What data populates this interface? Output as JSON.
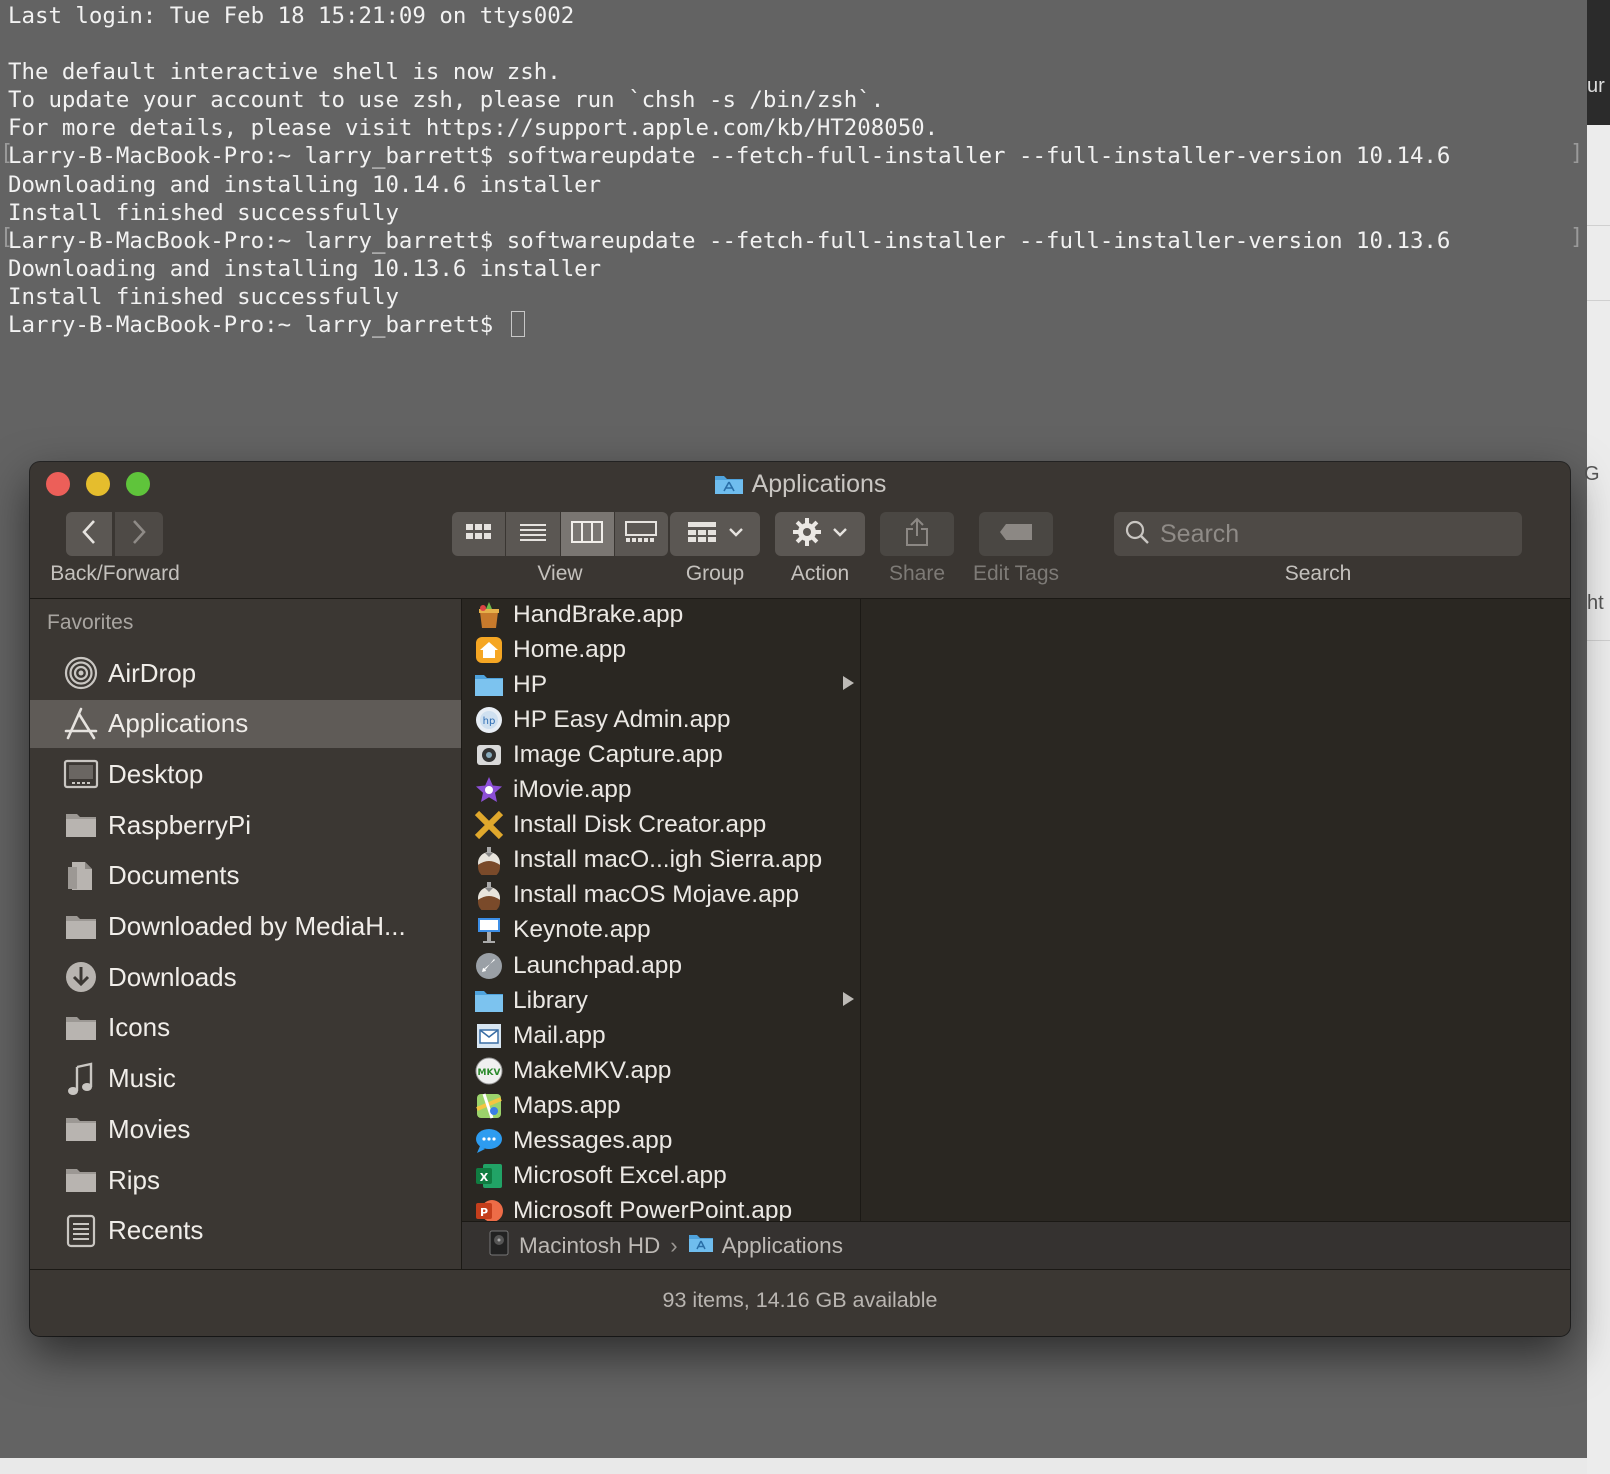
{
  "terminal": {
    "lines": [
      "Last login: Tue Feb 18 15:21:09 on ttys002",
      "",
      "The default interactive shell is now zsh.",
      "To update your account to use zsh, please run `chsh -s /bin/zsh`.",
      "For more details, please visit https://support.apple.com/kb/HT208050.",
      "Larry-B-MacBook-Pro:~ larry_barrett$ softwareupdate --fetch-full-installer --full-installer-version 10.14.6",
      "Downloading and installing 10.14.6 installer",
      "Install finished successfully",
      "Larry-B-MacBook-Pro:~ larry_barrett$ softwareupdate --fetch-full-installer --full-installer-version 10.13.6",
      "Downloading and installing 10.13.6 installer",
      "Install finished successfully"
    ],
    "prompt": "Larry-B-MacBook-Pro:~ larry_barrett$ ",
    "bg_color": "#636363",
    "text_color": "#f2f2f2"
  },
  "background_window": {
    "fragments": [
      "ur",
      "G",
      "ht"
    ]
  },
  "finder": {
    "title": "Applications",
    "toolbar": {
      "back_forward_label": "Back/Forward",
      "view_label": "View",
      "group_label": "Group",
      "action_label": "Action",
      "share_label": "Share",
      "edit_tags_label": "Edit Tags",
      "search_label": "Search",
      "search_placeholder": "Search"
    },
    "sidebar": {
      "header": "Favorites",
      "items": [
        {
          "label": "AirDrop",
          "icon": "airdrop-icon",
          "selected": false
        },
        {
          "label": "Applications",
          "icon": "applications-icon",
          "selected": true
        },
        {
          "label": "Desktop",
          "icon": "desktop-icon",
          "selected": false
        },
        {
          "label": "RaspberryPi",
          "icon": "folder-icon",
          "selected": false
        },
        {
          "label": "Documents",
          "icon": "documents-icon",
          "selected": false
        },
        {
          "label": "Downloaded by MediaH...",
          "icon": "folder-icon",
          "selected": false
        },
        {
          "label": "Downloads",
          "icon": "downloads-icon",
          "selected": false
        },
        {
          "label": "Icons",
          "icon": "folder-icon",
          "selected": false
        },
        {
          "label": "Music",
          "icon": "music-icon",
          "selected": false
        },
        {
          "label": "Movies",
          "icon": "folder-icon",
          "selected": false
        },
        {
          "label": "Rips",
          "icon": "folder-icon",
          "selected": false
        },
        {
          "label": "Recents",
          "icon": "recents-icon",
          "selected": false
        }
      ]
    },
    "files": [
      {
        "label": "HandBrake.app",
        "icon": "handbrake-icon",
        "folder": false
      },
      {
        "label": "Home.app",
        "icon": "home-icon",
        "folder": false
      },
      {
        "label": "HP",
        "icon": "folder-icon",
        "folder": true
      },
      {
        "label": "HP Easy Admin.app",
        "icon": "hp-easy-admin-icon",
        "folder": false
      },
      {
        "label": "Image Capture.app",
        "icon": "image-capture-icon",
        "folder": false
      },
      {
        "label": "iMovie.app",
        "icon": "imovie-icon",
        "folder": false
      },
      {
        "label": "Install Disk Creator.app",
        "icon": "install-disk-creator-icon",
        "folder": false
      },
      {
        "label": "Install macO...igh Sierra.app",
        "icon": "macos-installer-icon",
        "folder": false
      },
      {
        "label": "Install macOS Mojave.app",
        "icon": "macos-installer-icon",
        "folder": false
      },
      {
        "label": "Keynote.app",
        "icon": "keynote-icon",
        "folder": false
      },
      {
        "label": "Launchpad.app",
        "icon": "launchpad-icon",
        "folder": false
      },
      {
        "label": "Library",
        "icon": "folder-icon",
        "folder": true
      },
      {
        "label": "Mail.app",
        "icon": "mail-icon",
        "folder": false
      },
      {
        "label": "MakeMKV.app",
        "icon": "makemkv-icon",
        "folder": false
      },
      {
        "label": "Maps.app",
        "icon": "maps-icon",
        "folder": false
      },
      {
        "label": "Messages.app",
        "icon": "messages-icon",
        "folder": false
      },
      {
        "label": "Microsoft Excel.app",
        "icon": "excel-icon",
        "folder": false
      },
      {
        "label": "Microsoft PowerPoint.app",
        "icon": "powerpoint-icon",
        "folder": false
      }
    ],
    "path_bar": [
      "Macintosh HD",
      "Applications"
    ],
    "path_separator": "›",
    "status": "93 items, 14.16 GB available"
  }
}
